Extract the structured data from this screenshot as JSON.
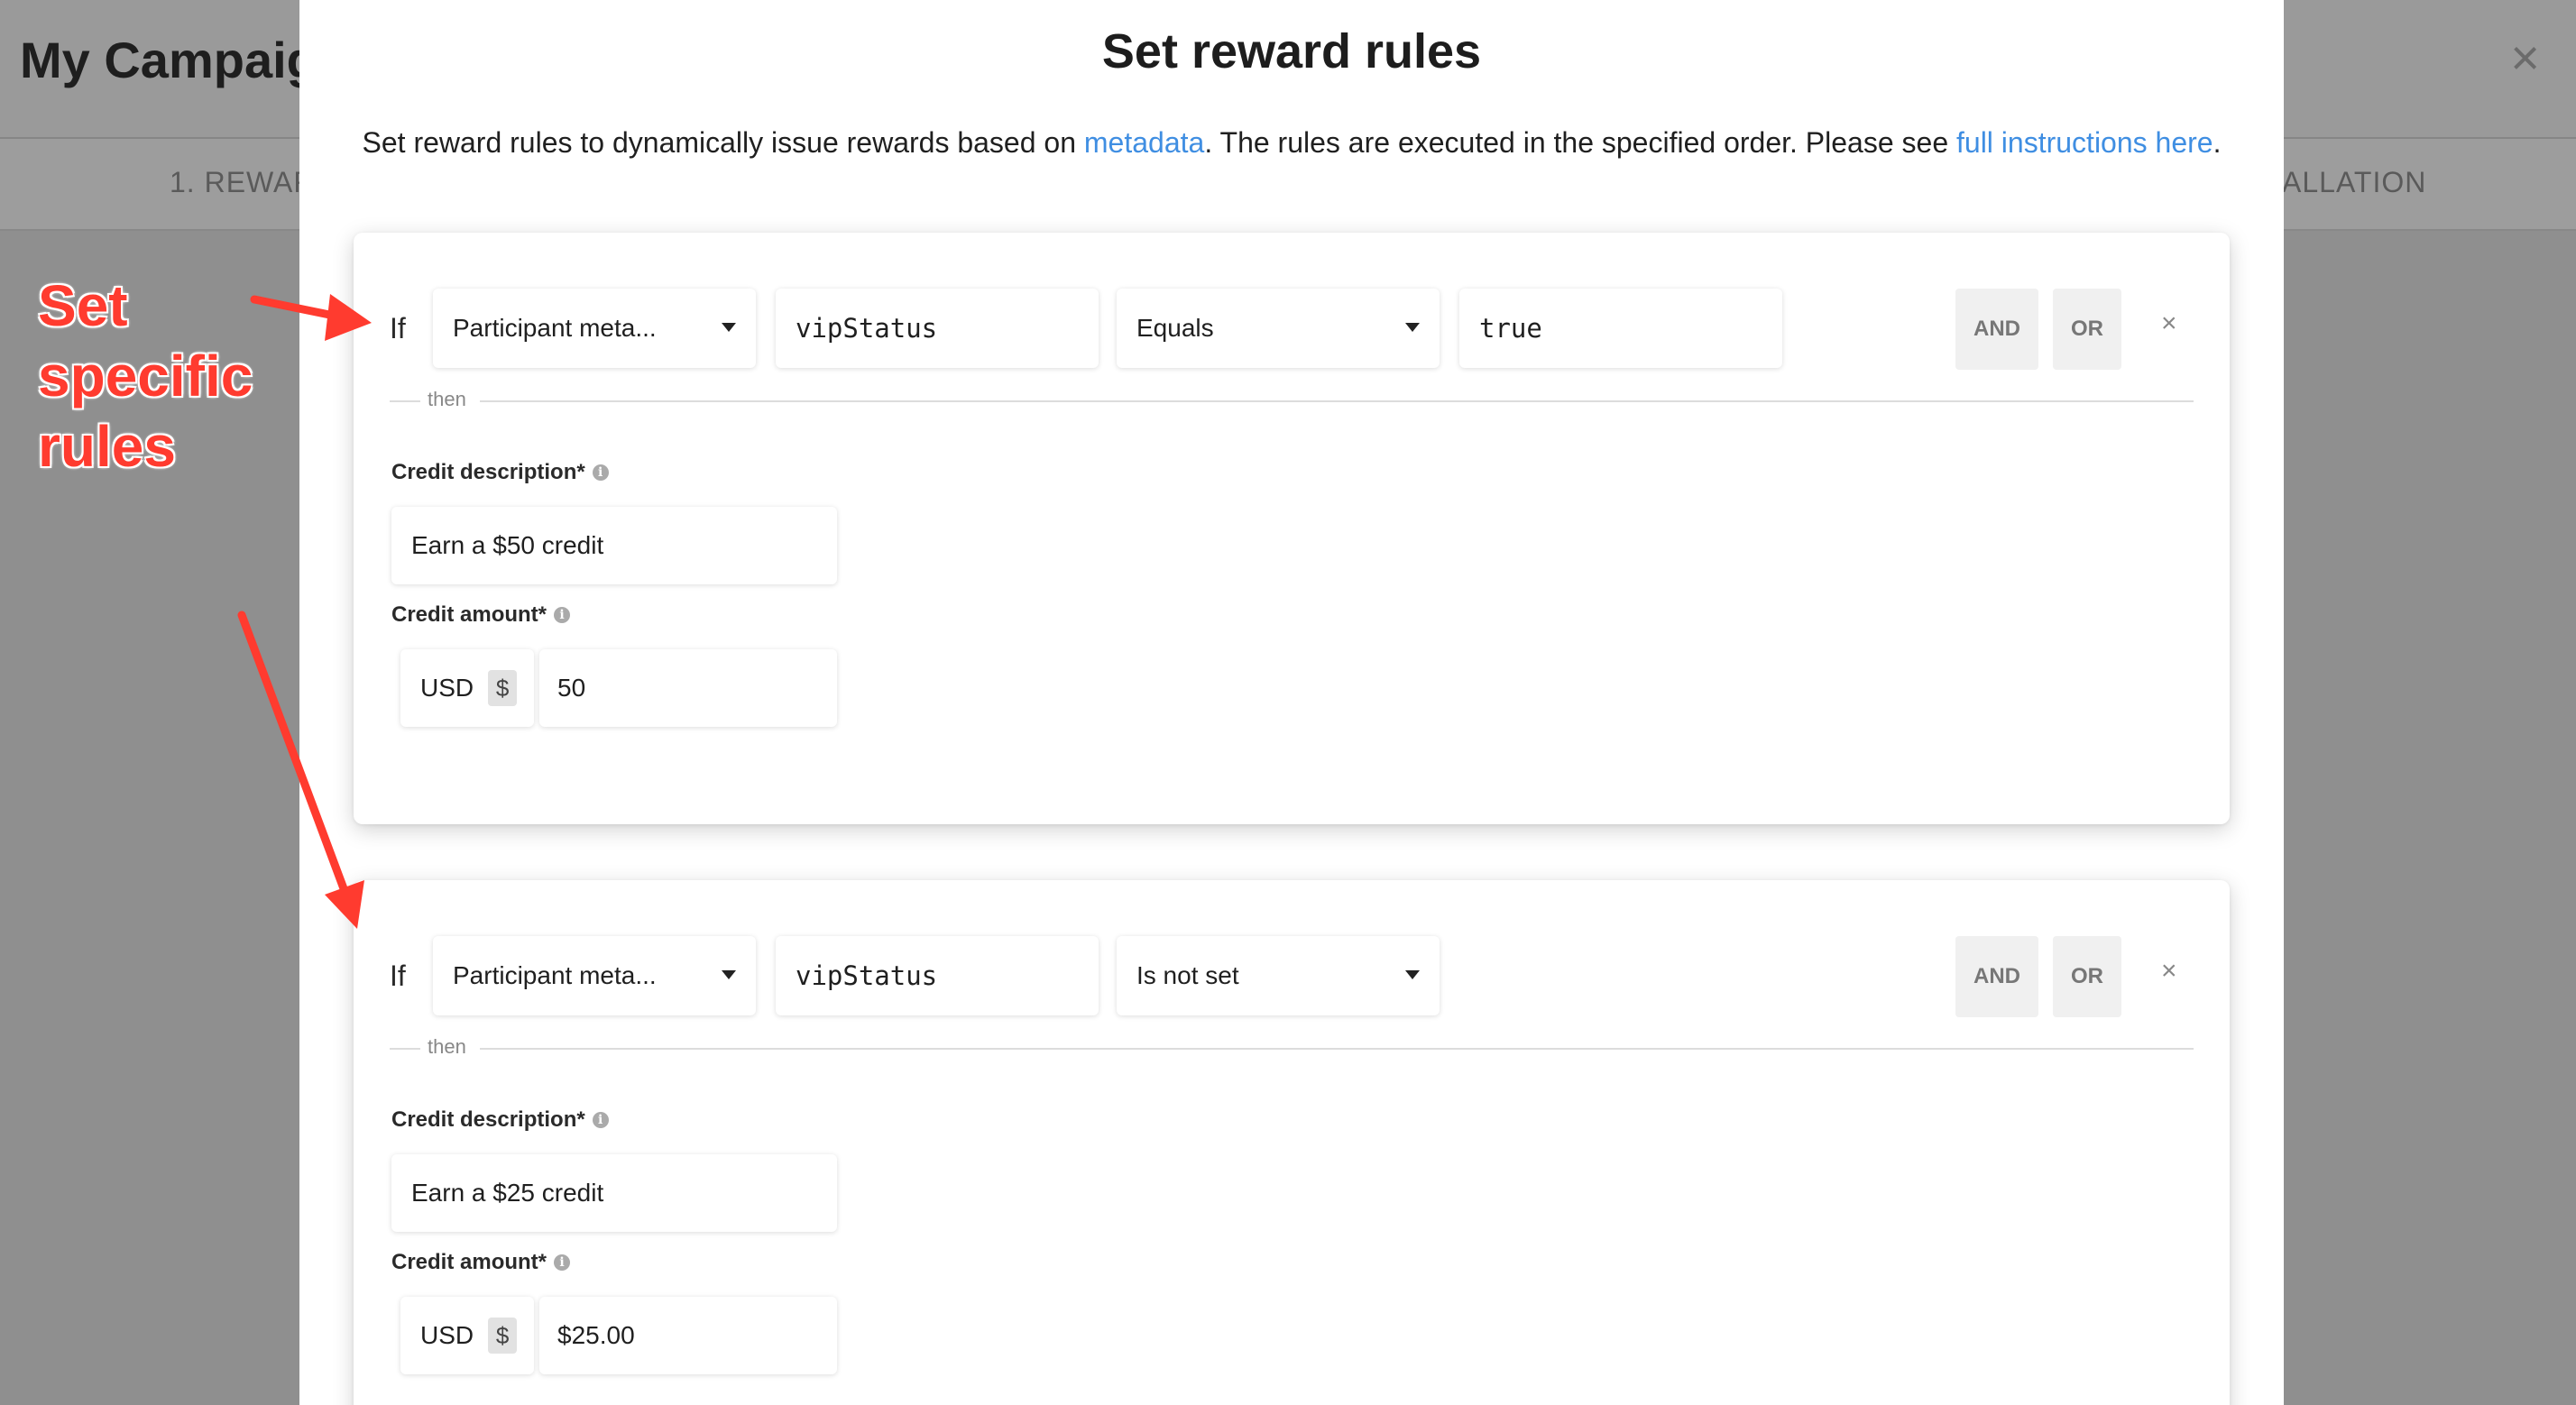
{
  "background": {
    "title": "My Campaig",
    "tab_left": "1. REWAR",
    "tab_right": "ALLATION",
    "close_symbol": "×"
  },
  "annotation": {
    "lines": [
      "Set",
      "specific",
      "rules"
    ],
    "color": "#ff3b2f"
  },
  "modal": {
    "title": "Set reward rules",
    "desc_before": "Set reward rules to dynamically issue rewards based on ",
    "desc_link1": "metadata",
    "desc_middle": ". The rules are executed in the specified order. Please see ",
    "desc_link2": "full instructions here",
    "desc_after": "."
  },
  "labels": {
    "if": "If",
    "then": "then",
    "and": "AND",
    "or": "OR",
    "remove": "×",
    "credit_description": "Credit description*",
    "credit_amount": "Credit amount*",
    "info": "i"
  },
  "rules": [
    {
      "source": "Participant meta...",
      "key": "vipStatus",
      "operator": "Equals",
      "value": "true",
      "credit_description": "Earn a $50 credit",
      "currency": "USD",
      "currency_symbol": "$",
      "amount": "50"
    },
    {
      "source": "Participant meta...",
      "key": "vipStatus",
      "operator": "Is not set",
      "credit_description": "Earn a $25 credit",
      "currency": "USD",
      "currency_symbol": "$",
      "amount": "$25.00"
    }
  ],
  "colors": {
    "link": "#3f8ee2",
    "annotation": "#ff3b2f",
    "overlay": "#8f8f8f"
  }
}
